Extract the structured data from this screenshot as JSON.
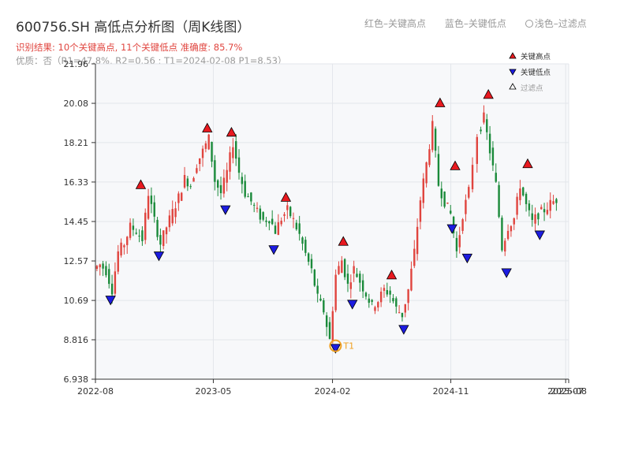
{
  "header": {
    "title": "600756.SH 高低点分析图（周K线图）",
    "result_text": "识别结果: 10个关键高点, 11个关键低点  准确度: 85.7%",
    "quality_text": "优质：否（R1=47.8%, R2=0.56 ; T1=2024-02-08 P1=8.53）"
  },
  "legend_top": {
    "red": "红色–关键高点",
    "blue": "蓝色–关键低点",
    "hollow": "浅色–过滤点"
  },
  "colors": {
    "up": "#e0443e",
    "down": "#1a8a3a",
    "high": "#e8191f",
    "low": "#1c1ce0",
    "t1": "#f0a020",
    "plot_bg": "#f7f8fa"
  },
  "chart_data": {
    "type": "candlestick",
    "xlabel": "",
    "ylabel": "",
    "ylim": [
      6.938,
      21.96
    ],
    "yticks": [
      "6.938",
      "8.816",
      "10.69",
      "12.57",
      "14.45",
      "16.33",
      "18.21",
      "20.08",
      "21.96"
    ],
    "xlim": [
      "2022-08-01",
      "2025-08-01"
    ],
    "xticks": [
      {
        "label": "2022-08",
        "date": "2022-08-01"
      },
      {
        "label": "2023-05",
        "date": "2023-05-01"
      },
      {
        "label": "2024-02",
        "date": "2024-02-01"
      },
      {
        "label": "2024-11",
        "date": "2024-11-01"
      },
      {
        "label": "2025-07",
        "date": "2025-07-25"
      },
      {
        "label": "2025-08",
        "date": "2025-08-01"
      }
    ],
    "series_close": [
      [
        "2022-08-01",
        12.2
      ],
      [
        "2022-08-15",
        12.4
      ],
      [
        "2022-08-29",
        12.1
      ],
      [
        "2022-09-12",
        11.2
      ],
      [
        "2022-09-26",
        13.0
      ],
      [
        "2022-10-10",
        13.4
      ],
      [
        "2022-10-24",
        14.2
      ],
      [
        "2022-11-07",
        14.0
      ],
      [
        "2022-11-21",
        13.6
      ],
      [
        "2022-12-05",
        15.8
      ],
      [
        "2022-12-19",
        14.5
      ],
      [
        "2023-01-02",
        13.4
      ],
      [
        "2023-01-16",
        14.2
      ],
      [
        "2023-01-30",
        14.9
      ],
      [
        "2023-02-13",
        15.6
      ],
      [
        "2023-02-27",
        16.5
      ],
      [
        "2023-03-13",
        16.2
      ],
      [
        "2023-03-27",
        17.2
      ],
      [
        "2023-04-10",
        17.8
      ],
      [
        "2023-04-24",
        18.4
      ],
      [
        "2023-05-08",
        16.4
      ],
      [
        "2023-05-22",
        15.8
      ],
      [
        "2023-06-05",
        16.8
      ],
      [
        "2023-06-19",
        18.2
      ],
      [
        "2023-07-03",
        16.8
      ],
      [
        "2023-07-17",
        15.8
      ],
      [
        "2023-07-31",
        15.4
      ],
      [
        "2023-08-14",
        14.9
      ],
      [
        "2023-08-28",
        14.5
      ],
      [
        "2023-09-11",
        14.6
      ],
      [
        "2023-09-25",
        14.0
      ],
      [
        "2023-10-09",
        14.6
      ],
      [
        "2023-10-23",
        15.0
      ],
      [
        "2023-11-06",
        14.5
      ],
      [
        "2023-11-20",
        13.8
      ],
      [
        "2023-12-04",
        12.9
      ],
      [
        "2023-12-18",
        12.1
      ],
      [
        "2024-01-01",
        10.8
      ],
      [
        "2024-01-15",
        10.2
      ],
      [
        "2024-01-29",
        8.8
      ],
      [
        "2024-02-12",
        11.9
      ],
      [
        "2024-02-26",
        12.6
      ],
      [
        "2024-03-11",
        11.4
      ],
      [
        "2024-03-25",
        12.2
      ],
      [
        "2024-04-08",
        11.6
      ],
      [
        "2024-04-22",
        11.0
      ],
      [
        "2024-05-06",
        10.4
      ],
      [
        "2024-05-20",
        10.7
      ],
      [
        "2024-06-03",
        11.2
      ],
      [
        "2024-06-17",
        11.0
      ],
      [
        "2024-07-01",
        10.3
      ],
      [
        "2024-07-15",
        10.0
      ],
      [
        "2024-07-29",
        11.2
      ],
      [
        "2024-08-12",
        13.0
      ],
      [
        "2024-08-26",
        15.5
      ],
      [
        "2024-09-09",
        17.2
      ],
      [
        "2024-09-23",
        19.0
      ],
      [
        "2024-10-07",
        16.2
      ],
      [
        "2024-10-21",
        15.4
      ],
      [
        "2024-11-04",
        14.8
      ],
      [
        "2024-11-18",
        13.0
      ],
      [
        "2024-12-02",
        14.8
      ],
      [
        "2024-12-16",
        15.9
      ],
      [
        "2025-01-06",
        18.6
      ],
      [
        "2025-01-20",
        19.4
      ],
      [
        "2025-02-03",
        17.8
      ],
      [
        "2025-02-17",
        16.2
      ],
      [
        "2025-03-03",
        13.2
      ],
      [
        "2025-03-17",
        14.2
      ],
      [
        "2025-03-31",
        14.6
      ],
      [
        "2025-04-14",
        16.2
      ],
      [
        "2025-04-28",
        15.2
      ],
      [
        "2025-05-12",
        14.4
      ],
      [
        "2025-05-26",
        14.8
      ],
      [
        "2025-06-09",
        15.0
      ],
      [
        "2025-06-23",
        15.3
      ],
      [
        "2025-07-07",
        15.5
      ]
    ],
    "key_highs": [
      [
        "2022-11-14",
        15.9
      ],
      [
        "2023-04-17",
        18.6
      ],
      [
        "2023-06-12",
        18.4
      ],
      [
        "2023-10-16",
        15.3
      ],
      [
        "2024-02-26",
        13.2
      ],
      [
        "2024-06-17",
        11.6
      ],
      [
        "2024-10-07",
        19.8
      ],
      [
        "2024-11-11",
        16.8
      ],
      [
        "2025-01-27",
        20.2
      ],
      [
        "2025-04-28",
        16.9
      ]
    ],
    "key_lows": [
      [
        "2022-09-05",
        10.9
      ],
      [
        "2022-12-26",
        13.0
      ],
      [
        "2023-05-29",
        15.2
      ],
      [
        "2023-09-18",
        13.3
      ],
      [
        "2024-02-08",
        8.6
      ],
      [
        "2024-03-18",
        10.7
      ],
      [
        "2024-07-15",
        9.5
      ],
      [
        "2024-11-04",
        14.3
      ],
      [
        "2024-12-09",
        12.9
      ],
      [
        "2025-03-10",
        12.2
      ],
      [
        "2025-05-26",
        14.0
      ]
    ],
    "t1_point": {
      "date": "2024-02-08",
      "value": 8.53,
      "label": "T1"
    },
    "legend": {
      "high": "关键高点",
      "low": "关键低点",
      "filtered": "过滤点"
    }
  }
}
